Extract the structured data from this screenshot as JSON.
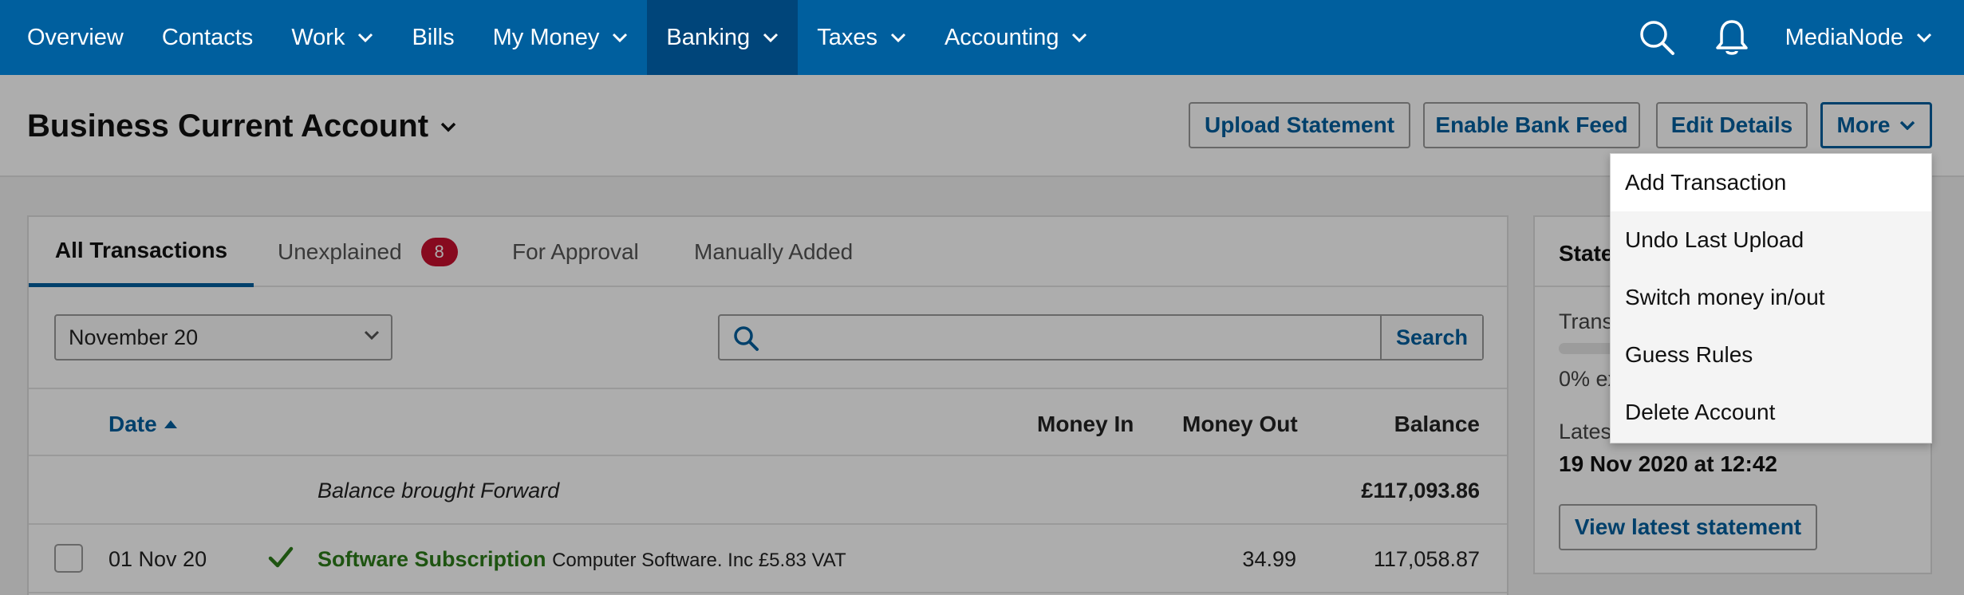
{
  "nav": {
    "items": [
      {
        "label": "Overview",
        "dropdown": false
      },
      {
        "label": "Contacts",
        "dropdown": false
      },
      {
        "label": "Work",
        "dropdown": true
      },
      {
        "label": "Bills",
        "dropdown": false
      },
      {
        "label": "My Money",
        "dropdown": true
      },
      {
        "label": "Banking",
        "dropdown": true,
        "active": true
      },
      {
        "label": "Taxes",
        "dropdown": true
      },
      {
        "label": "Accounting",
        "dropdown": true
      }
    ],
    "search_icon": "search-icon",
    "notifications_icon": "bell-icon",
    "user": "MediaNode"
  },
  "header": {
    "title": "Business Current Account",
    "buttons": {
      "upload": "Upload Statement",
      "bank_feed": "Enable Bank Feed",
      "edit": "Edit Details",
      "more": "More"
    }
  },
  "tabs": {
    "all": "All Transactions",
    "unexplained": "Unexplained",
    "unexplained_count": "8",
    "approval": "For Approval",
    "manual": "Manually Added"
  },
  "filters": {
    "date_value": "November 20",
    "search_placeholder": "",
    "search_button": "Search"
  },
  "table": {
    "columns": {
      "date": "Date",
      "money_in": "Money In",
      "money_out": "Money Out",
      "balance": "Balance"
    },
    "brought_forward": {
      "label": "Balance brought Forward",
      "balance": "£117,093.86"
    },
    "rows": [
      {
        "date": "01 Nov 20",
        "description": "Software Subscription",
        "detail": "Computer Software. Inc £5.83 VAT",
        "money_in": "",
        "money_out": "34.99",
        "balance": "117,058.87"
      }
    ]
  },
  "side": {
    "title": "Statement",
    "line1": "Transactions explained",
    "progress_fraction": 0.0,
    "line2": "0% explained",
    "latest_label": "Latest statement",
    "latest_value": "19 Nov 2020 at 12:42",
    "button": "View latest statement"
  },
  "dropdown": {
    "items": [
      "Add Transaction",
      "Undo Last Upload",
      "Switch money in/out",
      "Guess Rules",
      "Delete Account"
    ]
  },
  "colors": {
    "nav_bg": "#005f9e",
    "nav_active": "#00457a",
    "link": "#005f9e",
    "badge": "#c8102e",
    "check": "#2d7d1a"
  }
}
